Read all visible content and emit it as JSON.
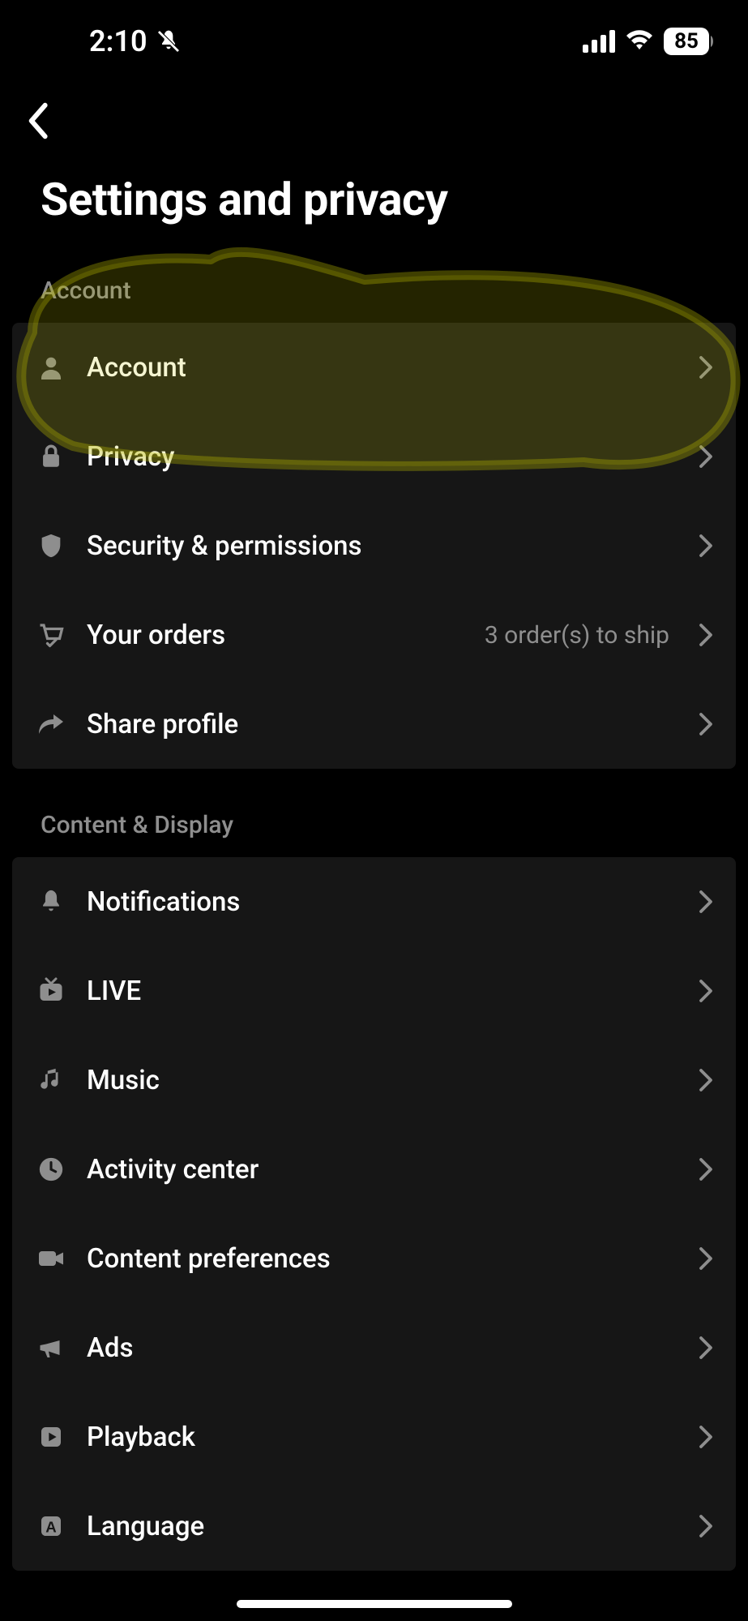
{
  "status_bar": {
    "time": "2:10",
    "battery_percent": "85"
  },
  "page": {
    "title": "Settings and privacy"
  },
  "sections": {
    "account": {
      "header": "Account",
      "items": [
        {
          "label": "Account",
          "icon": "person-icon",
          "detail": ""
        },
        {
          "label": "Privacy",
          "icon": "lock-icon",
          "detail": ""
        },
        {
          "label": "Security & permissions",
          "icon": "shield-icon",
          "detail": ""
        },
        {
          "label": "Your orders",
          "icon": "cart-icon",
          "detail": "3 order(s) to ship"
        },
        {
          "label": "Share profile",
          "icon": "share-icon",
          "detail": ""
        }
      ]
    },
    "content_display": {
      "header": "Content & Display",
      "items": [
        {
          "label": "Notifications",
          "icon": "bell-icon",
          "detail": ""
        },
        {
          "label": "LIVE",
          "icon": "tv-icon",
          "detail": ""
        },
        {
          "label": "Music",
          "icon": "music-icon",
          "detail": ""
        },
        {
          "label": "Activity center",
          "icon": "clock-icon",
          "detail": ""
        },
        {
          "label": "Content preferences",
          "icon": "camera-icon",
          "detail": ""
        },
        {
          "label": "Ads",
          "icon": "megaphone-icon",
          "detail": ""
        },
        {
          "label": "Playback",
          "icon": "play-icon",
          "detail": ""
        },
        {
          "label": "Language",
          "icon": "letter-a-icon",
          "detail": ""
        }
      ]
    }
  }
}
